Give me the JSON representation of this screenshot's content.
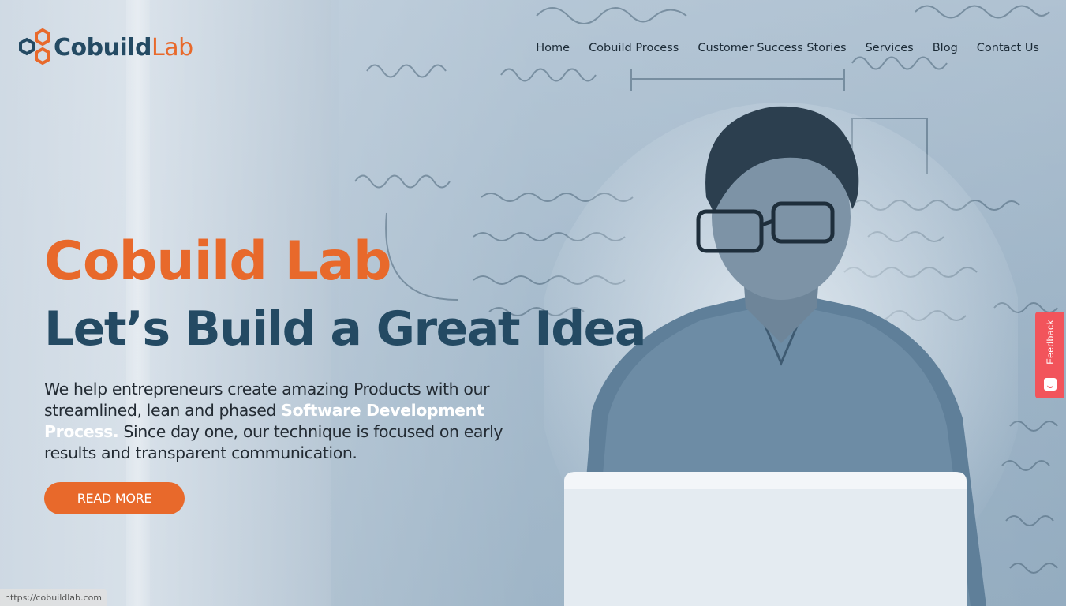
{
  "brand": {
    "name_part1": "Cobuild",
    "name_part2": "Lab",
    "orange": "#e8692b",
    "navy": "#244a63"
  },
  "nav": {
    "items": [
      {
        "label": "Home"
      },
      {
        "label": "Cobuild Process"
      },
      {
        "label": "Customer Success Stories"
      },
      {
        "label": "Services"
      },
      {
        "label": "Blog"
      },
      {
        "label": "Contact Us"
      }
    ]
  },
  "hero": {
    "title": "Cobuild Lab",
    "subtitle": "Let’s Build a Great Idea",
    "desc_part1": "We help entrepreneurs create amazing Products with our streamlined, lean and phased ",
    "desc_highlight": "Software Development Process.",
    "desc_part2": " Since day one, our technique is focused on early results and transparent communication.",
    "cta_label": "READ MORE"
  },
  "feedback": {
    "label": "Feedback",
    "color": "#f2545b"
  },
  "status_bar": {
    "url": "https://cobuildlab.com"
  },
  "icons": {
    "logo_mark": "hexagon-nodes-icon",
    "feedback": "smiley-icon"
  }
}
